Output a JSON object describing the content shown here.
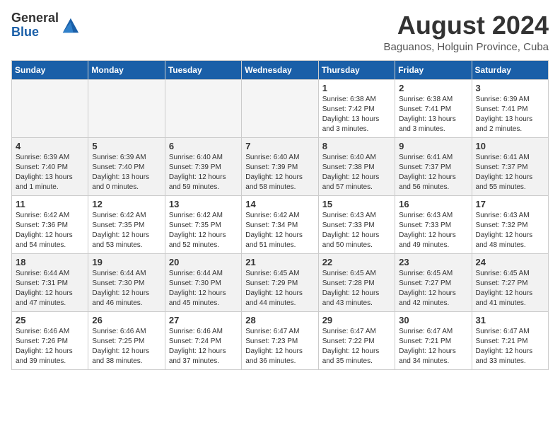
{
  "header": {
    "logo_general": "General",
    "logo_blue": "Blue",
    "title": "August 2024",
    "subtitle": "Baguanos, Holguin Province, Cuba"
  },
  "weekdays": [
    "Sunday",
    "Monday",
    "Tuesday",
    "Wednesday",
    "Thursday",
    "Friday",
    "Saturday"
  ],
  "weeks": [
    {
      "rowClass": "row-week1",
      "days": [
        {
          "num": "",
          "info": "",
          "empty": true
        },
        {
          "num": "",
          "info": "",
          "empty": true
        },
        {
          "num": "",
          "info": "",
          "empty": true
        },
        {
          "num": "",
          "info": "",
          "empty": true
        },
        {
          "num": "1",
          "info": "Sunrise: 6:38 AM\nSunset: 7:42 PM\nDaylight: 13 hours\nand 3 minutes."
        },
        {
          "num": "2",
          "info": "Sunrise: 6:38 AM\nSunset: 7:41 PM\nDaylight: 13 hours\nand 3 minutes."
        },
        {
          "num": "3",
          "info": "Sunrise: 6:39 AM\nSunset: 7:41 PM\nDaylight: 13 hours\nand 2 minutes."
        }
      ]
    },
    {
      "rowClass": "row-week2",
      "days": [
        {
          "num": "4",
          "info": "Sunrise: 6:39 AM\nSunset: 7:40 PM\nDaylight: 13 hours\nand 1 minute."
        },
        {
          "num": "5",
          "info": "Sunrise: 6:39 AM\nSunset: 7:40 PM\nDaylight: 13 hours\nand 0 minutes."
        },
        {
          "num": "6",
          "info": "Sunrise: 6:40 AM\nSunset: 7:39 PM\nDaylight: 12 hours\nand 59 minutes."
        },
        {
          "num": "7",
          "info": "Sunrise: 6:40 AM\nSunset: 7:39 PM\nDaylight: 12 hours\nand 58 minutes."
        },
        {
          "num": "8",
          "info": "Sunrise: 6:40 AM\nSunset: 7:38 PM\nDaylight: 12 hours\nand 57 minutes."
        },
        {
          "num": "9",
          "info": "Sunrise: 6:41 AM\nSunset: 7:37 PM\nDaylight: 12 hours\nand 56 minutes."
        },
        {
          "num": "10",
          "info": "Sunrise: 6:41 AM\nSunset: 7:37 PM\nDaylight: 12 hours\nand 55 minutes."
        }
      ]
    },
    {
      "rowClass": "row-week3",
      "days": [
        {
          "num": "11",
          "info": "Sunrise: 6:42 AM\nSunset: 7:36 PM\nDaylight: 12 hours\nand 54 minutes."
        },
        {
          "num": "12",
          "info": "Sunrise: 6:42 AM\nSunset: 7:35 PM\nDaylight: 12 hours\nand 53 minutes."
        },
        {
          "num": "13",
          "info": "Sunrise: 6:42 AM\nSunset: 7:35 PM\nDaylight: 12 hours\nand 52 minutes."
        },
        {
          "num": "14",
          "info": "Sunrise: 6:42 AM\nSunset: 7:34 PM\nDaylight: 12 hours\nand 51 minutes."
        },
        {
          "num": "15",
          "info": "Sunrise: 6:43 AM\nSunset: 7:33 PM\nDaylight: 12 hours\nand 50 minutes."
        },
        {
          "num": "16",
          "info": "Sunrise: 6:43 AM\nSunset: 7:33 PM\nDaylight: 12 hours\nand 49 minutes."
        },
        {
          "num": "17",
          "info": "Sunrise: 6:43 AM\nSunset: 7:32 PM\nDaylight: 12 hours\nand 48 minutes."
        }
      ]
    },
    {
      "rowClass": "row-week4",
      "days": [
        {
          "num": "18",
          "info": "Sunrise: 6:44 AM\nSunset: 7:31 PM\nDaylight: 12 hours\nand 47 minutes."
        },
        {
          "num": "19",
          "info": "Sunrise: 6:44 AM\nSunset: 7:30 PM\nDaylight: 12 hours\nand 46 minutes."
        },
        {
          "num": "20",
          "info": "Sunrise: 6:44 AM\nSunset: 7:30 PM\nDaylight: 12 hours\nand 45 minutes."
        },
        {
          "num": "21",
          "info": "Sunrise: 6:45 AM\nSunset: 7:29 PM\nDaylight: 12 hours\nand 44 minutes."
        },
        {
          "num": "22",
          "info": "Sunrise: 6:45 AM\nSunset: 7:28 PM\nDaylight: 12 hours\nand 43 minutes."
        },
        {
          "num": "23",
          "info": "Sunrise: 6:45 AM\nSunset: 7:27 PM\nDaylight: 12 hours\nand 42 minutes."
        },
        {
          "num": "24",
          "info": "Sunrise: 6:45 AM\nSunset: 7:27 PM\nDaylight: 12 hours\nand 41 minutes."
        }
      ]
    },
    {
      "rowClass": "row-week5",
      "days": [
        {
          "num": "25",
          "info": "Sunrise: 6:46 AM\nSunset: 7:26 PM\nDaylight: 12 hours\nand 39 minutes."
        },
        {
          "num": "26",
          "info": "Sunrise: 6:46 AM\nSunset: 7:25 PM\nDaylight: 12 hours\nand 38 minutes."
        },
        {
          "num": "27",
          "info": "Sunrise: 6:46 AM\nSunset: 7:24 PM\nDaylight: 12 hours\nand 37 minutes."
        },
        {
          "num": "28",
          "info": "Sunrise: 6:47 AM\nSunset: 7:23 PM\nDaylight: 12 hours\nand 36 minutes."
        },
        {
          "num": "29",
          "info": "Sunrise: 6:47 AM\nSunset: 7:22 PM\nDaylight: 12 hours\nand 35 minutes."
        },
        {
          "num": "30",
          "info": "Sunrise: 6:47 AM\nSunset: 7:21 PM\nDaylight: 12 hours\nand 34 minutes."
        },
        {
          "num": "31",
          "info": "Sunrise: 6:47 AM\nSunset: 7:21 PM\nDaylight: 12 hours\nand 33 minutes."
        }
      ]
    }
  ]
}
